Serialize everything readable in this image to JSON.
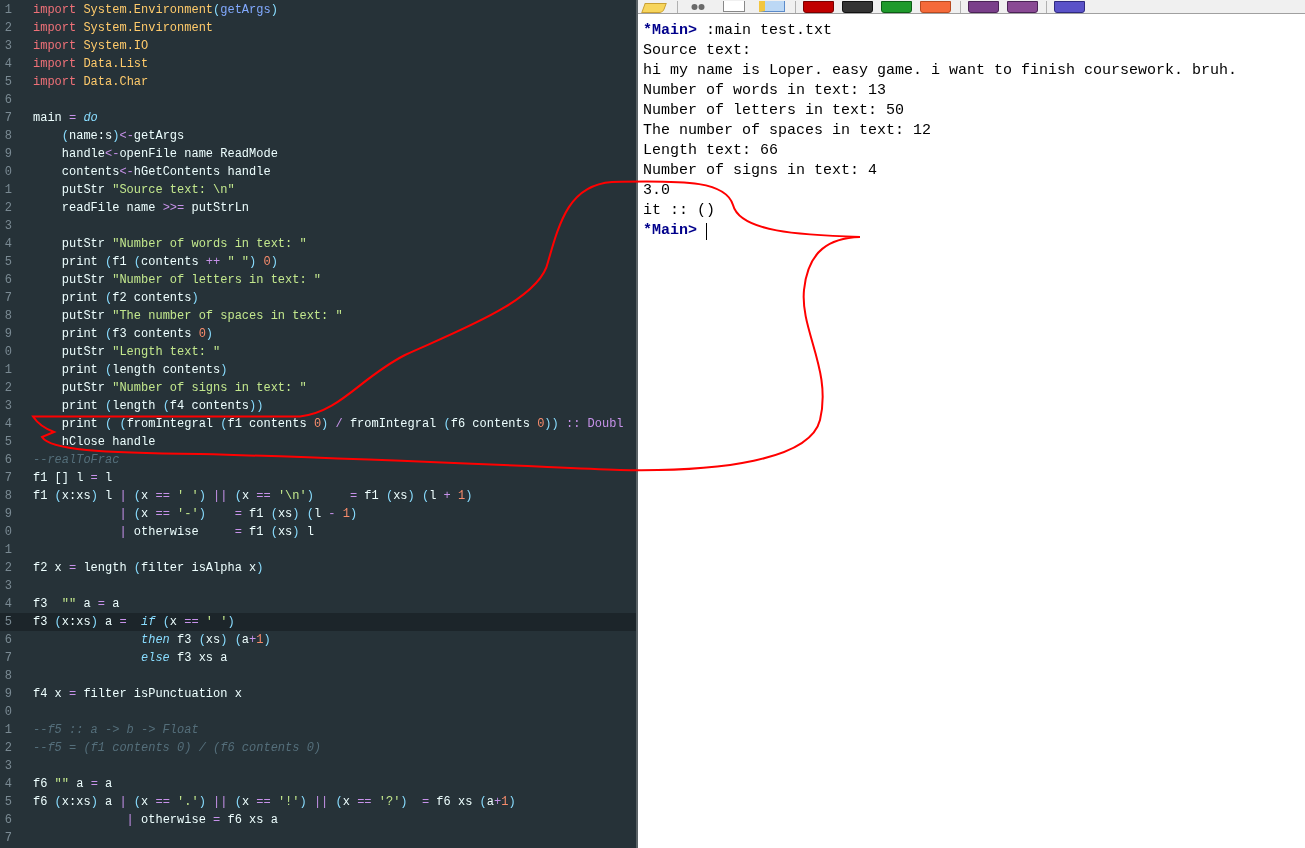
{
  "editor": {
    "lines": [
      {
        "number": "1",
        "current": false,
        "tokens": [
          {
            "kind": "kw",
            "text": "import"
          },
          {
            "kind": "mod",
            "text": " System.Environment"
          },
          {
            "kind": "par",
            "text": "("
          },
          {
            "kind": "fn",
            "text": "getArgs"
          },
          {
            "kind": "par",
            "text": ")"
          }
        ]
      },
      {
        "number": "2",
        "current": false,
        "tokens": [
          {
            "kind": "kw",
            "text": "import"
          },
          {
            "kind": "mod",
            "text": " System.Environment"
          }
        ]
      },
      {
        "number": "3",
        "current": false,
        "tokens": [
          {
            "kind": "kw",
            "text": "import"
          },
          {
            "kind": "mod",
            "text": " System.IO"
          }
        ]
      },
      {
        "number": "4",
        "current": false,
        "tokens": [
          {
            "kind": "kw",
            "text": "import"
          },
          {
            "kind": "mod",
            "text": " Data.List"
          }
        ]
      },
      {
        "number": "5",
        "current": false,
        "tokens": [
          {
            "kind": "kw",
            "text": "import"
          },
          {
            "kind": "mod",
            "text": " Data.Char"
          }
        ]
      },
      {
        "number": "6",
        "current": false
      },
      {
        "number": "7",
        "current": false,
        "tokens": [
          {
            "kind": "tx",
            "text": "main "
          },
          {
            "kind": "op",
            "text": "="
          },
          {
            "kind": "it",
            "text": " do"
          }
        ]
      },
      {
        "number": "8",
        "current": false,
        "tokens": [
          {
            "kind": "par",
            "text": "    ("
          },
          {
            "kind": "tx",
            "text": "name:s"
          },
          {
            "kind": "par",
            "text": ")"
          },
          {
            "kind": "op",
            "text": "<-"
          },
          {
            "kind": "tx",
            "text": "getArgs"
          }
        ]
      },
      {
        "number": "9",
        "current": false,
        "tokens": [
          {
            "kind": "tx",
            "text": "    handle"
          },
          {
            "kind": "op",
            "text": "<-"
          },
          {
            "kind": "tx",
            "text": "openFile name ReadMode"
          }
        ]
      },
      {
        "number": "0",
        "current": false,
        "tokens": [
          {
            "kind": "tx",
            "text": "    contents"
          },
          {
            "kind": "op",
            "text": "<-"
          },
          {
            "kind": "tx",
            "text": "hGetContents handle"
          }
        ]
      },
      {
        "number": "1",
        "current": false,
        "tokens": [
          {
            "kind": "tx",
            "text": "    putStr "
          },
          {
            "kind": "str",
            "text": "\"Source text: \\n\""
          }
        ]
      },
      {
        "number": "2",
        "current": false,
        "tokens": [
          {
            "kind": "tx",
            "text": "    readFile name "
          },
          {
            "kind": "op",
            "text": ">>="
          },
          {
            "kind": "tx",
            "text": " putStrLn"
          }
        ]
      },
      {
        "number": "3",
        "current": false
      },
      {
        "number": "4",
        "current": false,
        "tokens": [
          {
            "kind": "tx",
            "text": "    putStr "
          },
          {
            "kind": "str",
            "text": "\"Number of words in text: \""
          }
        ]
      },
      {
        "number": "5",
        "current": false,
        "tokens": [
          {
            "kind": "tx",
            "text": "    print "
          },
          {
            "kind": "par",
            "text": "("
          },
          {
            "kind": "tx",
            "text": "f1 "
          },
          {
            "kind": "par",
            "text": "("
          },
          {
            "kind": "tx",
            "text": "contents "
          },
          {
            "kind": "op",
            "text": "++"
          },
          {
            "kind": "str",
            "text": " \" \""
          },
          {
            "kind": "par",
            "text": ")"
          },
          {
            "kind": "num",
            "text": " 0"
          },
          {
            "kind": "par",
            "text": ")"
          }
        ]
      },
      {
        "number": "6",
        "current": false,
        "tokens": [
          {
            "kind": "tx",
            "text": "    putStr "
          },
          {
            "kind": "str",
            "text": "\"Number of letters in text: \""
          }
        ]
      },
      {
        "number": "7",
        "current": false,
        "tokens": [
          {
            "kind": "tx",
            "text": "    print "
          },
          {
            "kind": "par",
            "text": "("
          },
          {
            "kind": "tx",
            "text": "f2 contents"
          },
          {
            "kind": "par",
            "text": ")"
          }
        ]
      },
      {
        "number": "8",
        "current": false,
        "tokens": [
          {
            "kind": "tx",
            "text": "    putStr "
          },
          {
            "kind": "str",
            "text": "\"The number of spaces in text: \""
          }
        ]
      },
      {
        "number": "9",
        "current": false,
        "tokens": [
          {
            "kind": "tx",
            "text": "    print "
          },
          {
            "kind": "par",
            "text": "("
          },
          {
            "kind": "tx",
            "text": "f3 contents "
          },
          {
            "kind": "num",
            "text": "0"
          },
          {
            "kind": "par",
            "text": ")"
          }
        ]
      },
      {
        "number": "0",
        "current": false,
        "tokens": [
          {
            "kind": "tx",
            "text": "    putStr "
          },
          {
            "kind": "str",
            "text": "\"Length text: \""
          }
        ]
      },
      {
        "number": "1",
        "current": false,
        "tokens": [
          {
            "kind": "tx",
            "text": "    print "
          },
          {
            "kind": "par",
            "text": "("
          },
          {
            "kind": "tx",
            "text": "length contents"
          },
          {
            "kind": "par",
            "text": ")"
          }
        ]
      },
      {
        "number": "2",
        "current": false,
        "tokens": [
          {
            "kind": "tx",
            "text": "    putStr "
          },
          {
            "kind": "str",
            "text": "\"Number of signs in text: \""
          }
        ]
      },
      {
        "number": "3",
        "current": false,
        "tokens": [
          {
            "kind": "tx",
            "text": "    print "
          },
          {
            "kind": "par",
            "text": "("
          },
          {
            "kind": "tx",
            "text": "length "
          },
          {
            "kind": "par",
            "text": "("
          },
          {
            "kind": "tx",
            "text": "f4 contents"
          },
          {
            "kind": "par",
            "text": "))"
          }
        ]
      },
      {
        "number": "4",
        "current": false,
        "tokens": [
          {
            "kind": "tx",
            "text": "    print "
          },
          {
            "kind": "par",
            "text": "( ("
          },
          {
            "kind": "tx",
            "text": "fromIntegral "
          },
          {
            "kind": "par",
            "text": "("
          },
          {
            "kind": "tx",
            "text": "f1 contents "
          },
          {
            "kind": "num",
            "text": "0"
          },
          {
            "kind": "par",
            "text": ")"
          },
          {
            "kind": "op",
            "text": " /"
          },
          {
            "kind": "tx",
            "text": " fromIntegral "
          },
          {
            "kind": "par",
            "text": "("
          },
          {
            "kind": "tx",
            "text": "f6 contents "
          },
          {
            "kind": "num",
            "text": "0"
          },
          {
            "kind": "par",
            "text": "))"
          },
          {
            "kind": "op",
            "text": " :: Doubl"
          }
        ]
      },
      {
        "number": "5",
        "current": false,
        "tokens": [
          {
            "kind": "tx",
            "text": "    hClose handle"
          }
        ]
      },
      {
        "number": "6",
        "current": false,
        "tokens": [
          {
            "kind": "cm",
            "text": "--realToFrac"
          }
        ]
      },
      {
        "number": "7",
        "current": false,
        "tokens": [
          {
            "kind": "tx",
            "text": "f1 [] l "
          },
          {
            "kind": "op",
            "text": "="
          },
          {
            "kind": "tx",
            "text": " l"
          }
        ]
      },
      {
        "number": "8",
        "current": false,
        "tokens": [
          {
            "kind": "tx",
            "text": "f1 "
          },
          {
            "kind": "par",
            "text": "("
          },
          {
            "kind": "tx",
            "text": "x:xs"
          },
          {
            "kind": "par",
            "text": ")"
          },
          {
            "kind": "tx",
            "text": " l "
          },
          {
            "kind": "op",
            "text": "|"
          },
          {
            "kind": "par",
            "text": " ("
          },
          {
            "kind": "tx",
            "text": "x "
          },
          {
            "kind": "op",
            "text": "=="
          },
          {
            "kind": "str",
            "text": " ' '"
          },
          {
            "kind": "par",
            "text": ")"
          },
          {
            "kind": "op",
            "text": " ||"
          },
          {
            "kind": "par",
            "text": " ("
          },
          {
            "kind": "tx",
            "text": "x "
          },
          {
            "kind": "op",
            "text": "=="
          },
          {
            "kind": "str",
            "text": " '\\n'"
          },
          {
            "kind": "par",
            "text": ")"
          },
          {
            "kind": "op",
            "text": "     ="
          },
          {
            "kind": "tx",
            "text": " f1 "
          },
          {
            "kind": "par",
            "text": "("
          },
          {
            "kind": "tx",
            "text": "xs"
          },
          {
            "kind": "par",
            "text": ")"
          },
          {
            "kind": "par",
            "text": " ("
          },
          {
            "kind": "tx",
            "text": "l "
          },
          {
            "kind": "op",
            "text": "+"
          },
          {
            "kind": "num",
            "text": " 1"
          },
          {
            "kind": "par",
            "text": ")"
          }
        ]
      },
      {
        "number": "9",
        "current": false,
        "tokens": [
          {
            "kind": "op",
            "text": "            |"
          },
          {
            "kind": "par",
            "text": " ("
          },
          {
            "kind": "tx",
            "text": "x "
          },
          {
            "kind": "op",
            "text": "=="
          },
          {
            "kind": "str",
            "text": " '-'"
          },
          {
            "kind": "par",
            "text": ")"
          },
          {
            "kind": "op",
            "text": "    ="
          },
          {
            "kind": "tx",
            "text": " f1 "
          },
          {
            "kind": "par",
            "text": "("
          },
          {
            "kind": "tx",
            "text": "xs"
          },
          {
            "kind": "par",
            "text": ")"
          },
          {
            "kind": "par",
            "text": " ("
          },
          {
            "kind": "tx",
            "text": "l "
          },
          {
            "kind": "op",
            "text": "-"
          },
          {
            "kind": "num",
            "text": " 1"
          },
          {
            "kind": "par",
            "text": ")"
          }
        ]
      },
      {
        "number": "0",
        "current": false,
        "tokens": [
          {
            "kind": "op",
            "text": "            |"
          },
          {
            "kind": "tx",
            "text": " otherwise     "
          },
          {
            "kind": "op",
            "text": "="
          },
          {
            "kind": "tx",
            "text": " f1 "
          },
          {
            "kind": "par",
            "text": "("
          },
          {
            "kind": "tx",
            "text": "xs"
          },
          {
            "kind": "par",
            "text": ")"
          },
          {
            "kind": "tx",
            "text": " l"
          }
        ]
      },
      {
        "number": "1",
        "current": false
      },
      {
        "number": "2",
        "current": false,
        "tokens": [
          {
            "kind": "tx",
            "text": "f2 x "
          },
          {
            "kind": "op",
            "text": "="
          },
          {
            "kind": "tx",
            "text": " length "
          },
          {
            "kind": "par",
            "text": "("
          },
          {
            "kind": "tx",
            "text": "filter isAlpha x"
          },
          {
            "kind": "par",
            "text": ")"
          }
        ]
      },
      {
        "number": "3",
        "current": false
      },
      {
        "number": "4",
        "current": false,
        "tokens": [
          {
            "kind": "tx",
            "text": "f3  "
          },
          {
            "kind": "str",
            "text": "\"\""
          },
          {
            "kind": "tx",
            "text": " a "
          },
          {
            "kind": "op",
            "text": "="
          },
          {
            "kind": "tx",
            "text": " a"
          }
        ]
      },
      {
        "number": "5",
        "current": true,
        "tokens": [
          {
            "kind": "tx",
            "text": "f3 "
          },
          {
            "kind": "par",
            "text": "("
          },
          {
            "kind": "tx",
            "text": "x:xs"
          },
          {
            "kind": "par",
            "text": ")"
          },
          {
            "kind": "tx",
            "text": " a "
          },
          {
            "kind": "op",
            "text": "="
          },
          {
            "kind": "it",
            "text": "  if"
          },
          {
            "kind": "par",
            "text": " ("
          },
          {
            "kind": "tx",
            "text": "x "
          },
          {
            "kind": "op",
            "text": "=="
          },
          {
            "kind": "str",
            "text": " ' '"
          },
          {
            "kind": "par",
            "text": ")"
          }
        ]
      },
      {
        "number": "6",
        "current": false,
        "tokens": [
          {
            "kind": "it",
            "text": "               then"
          },
          {
            "kind": "tx",
            "text": " f3 "
          },
          {
            "kind": "par",
            "text": "("
          },
          {
            "kind": "tx",
            "text": "xs"
          },
          {
            "kind": "par",
            "text": ")"
          },
          {
            "kind": "par",
            "text": " ("
          },
          {
            "kind": "tx",
            "text": "a"
          },
          {
            "kind": "op",
            "text": "+"
          },
          {
            "kind": "num",
            "text": "1"
          },
          {
            "kind": "par",
            "text": ")"
          }
        ]
      },
      {
        "number": "7",
        "current": false,
        "tokens": [
          {
            "kind": "it",
            "text": "               else"
          },
          {
            "kind": "tx",
            "text": " f3 xs a"
          }
        ]
      },
      {
        "number": "8",
        "current": false
      },
      {
        "number": "9",
        "current": false,
        "tokens": [
          {
            "kind": "tx",
            "text": "f4 x "
          },
          {
            "kind": "op",
            "text": "="
          },
          {
            "kind": "tx",
            "text": " filter isPunctuation x"
          }
        ]
      },
      {
        "number": "0",
        "current": false
      },
      {
        "number": "1",
        "current": false,
        "tokens": [
          {
            "kind": "cm",
            "text": "--f5 :: a -> b -> Float"
          }
        ]
      },
      {
        "number": "2",
        "current": false,
        "tokens": [
          {
            "kind": "cm",
            "text": "--f5 = (f1 contents 0) / (f6 contents 0)"
          }
        ]
      },
      {
        "number": "3",
        "current": false
      },
      {
        "number": "4",
        "current": false,
        "tokens": [
          {
            "kind": "tx",
            "text": "f6 "
          },
          {
            "kind": "str",
            "text": "\"\""
          },
          {
            "kind": "tx",
            "text": " a "
          },
          {
            "kind": "op",
            "text": "="
          },
          {
            "kind": "tx",
            "text": " a"
          }
        ]
      },
      {
        "number": "5",
        "current": false,
        "tokens": [
          {
            "kind": "tx",
            "text": "f6 "
          },
          {
            "kind": "par",
            "text": "("
          },
          {
            "kind": "tx",
            "text": "x:xs"
          },
          {
            "kind": "par",
            "text": ")"
          },
          {
            "kind": "tx",
            "text": " a "
          },
          {
            "kind": "op",
            "text": "|"
          },
          {
            "kind": "par",
            "text": " ("
          },
          {
            "kind": "tx",
            "text": "x "
          },
          {
            "kind": "op",
            "text": "=="
          },
          {
            "kind": "str",
            "text": " '.'"
          },
          {
            "kind": "par",
            "text": ")"
          },
          {
            "kind": "op",
            "text": " ||"
          },
          {
            "kind": "par",
            "text": " ("
          },
          {
            "kind": "tx",
            "text": "x "
          },
          {
            "kind": "op",
            "text": "=="
          },
          {
            "kind": "str",
            "text": " '!'"
          },
          {
            "kind": "par",
            "text": ")"
          },
          {
            "kind": "op",
            "text": " ||"
          },
          {
            "kind": "par",
            "text": " ("
          },
          {
            "kind": "tx",
            "text": "x "
          },
          {
            "kind": "op",
            "text": "=="
          },
          {
            "kind": "str",
            "text": " '?'"
          },
          {
            "kind": "par",
            "text": ")"
          },
          {
            "kind": "op",
            "text": "  ="
          },
          {
            "kind": "tx",
            "text": " f6 xs "
          },
          {
            "kind": "par",
            "text": "("
          },
          {
            "kind": "tx",
            "text": "a"
          },
          {
            "kind": "op",
            "text": "+"
          },
          {
            "kind": "num",
            "text": "1"
          },
          {
            "kind": "par",
            "text": ")"
          }
        ]
      },
      {
        "number": "6",
        "current": false,
        "tokens": [
          {
            "kind": "op",
            "text": "             |"
          },
          {
            "kind": "tx",
            "text": " otherwise "
          },
          {
            "kind": "op",
            "text": "="
          },
          {
            "kind": "tx",
            "text": " f6 xs a"
          }
        ]
      },
      {
        "number": "7",
        "current": false
      }
    ]
  },
  "console": {
    "lines": [
      {
        "kind": "prompt",
        "prompt": "*Main>",
        "text": ":main test.txt",
        "cursor": false
      },
      {
        "kind": "output",
        "text": "Source text:"
      },
      {
        "kind": "output",
        "text": "hi my name is Loper. easy game. i want to finish coursework. bruh."
      },
      {
        "kind": "output",
        "text": "Number of words in text: 13"
      },
      {
        "kind": "output",
        "text": "Number of letters in text: 50"
      },
      {
        "kind": "output",
        "text": "The number of spaces in text: 12"
      },
      {
        "kind": "output",
        "text": "Length text: 66"
      },
      {
        "kind": "output",
        "text": "Number of signs in text: 4"
      },
      {
        "kind": "output",
        "text": "3.0"
      },
      {
        "kind": "output",
        "text": "it :: ()"
      },
      {
        "kind": "prompt",
        "prompt": "*Main>",
        "cursor": true
      }
    ]
  }
}
